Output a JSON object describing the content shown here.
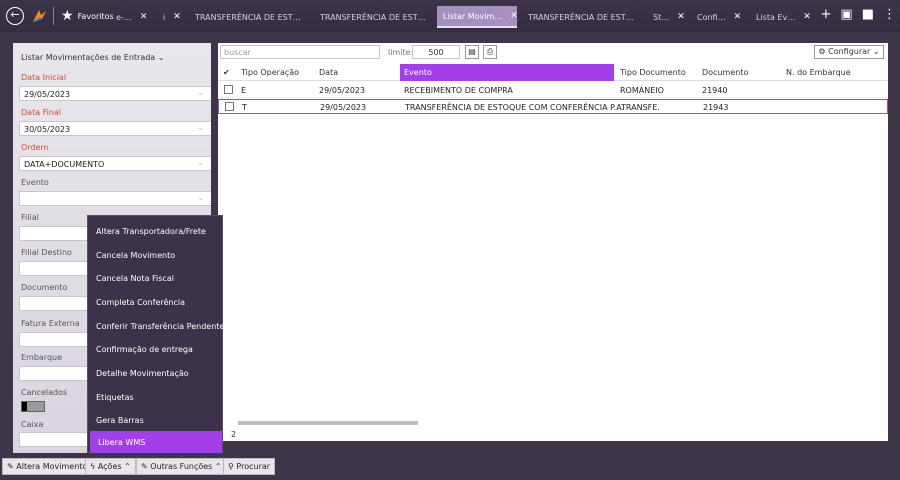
{
  "topbar": {
    "favorites_label": "Favoritos",
    "tabs": [
      {
        "label": "e-…",
        "active": false
      },
      {
        "label": "i",
        "active": false
      },
      {
        "label": "TRANSFERÊNCIA DE EST…",
        "active": false
      },
      {
        "label": "TRANSFERÊNCIA DE EST…",
        "active": false
      },
      {
        "label": "Listar Movim…",
        "active": true
      },
      {
        "label": "TRANSFERÊNCIA DE EST…",
        "active": false
      },
      {
        "label": "St…",
        "active": false
      },
      {
        "label": "Confi…",
        "active": false
      },
      {
        "label": "Lista Ev…",
        "active": false
      }
    ],
    "accent_color": "#a33fe8"
  },
  "sidebar": {
    "title": "Listar Movimentações de Entrada ⌄",
    "filters": [
      {
        "label": "Data Inicial",
        "value": "29/05/2023",
        "required": true
      },
      {
        "label": "Data Final",
        "value": "30/05/2023",
        "required": true
      },
      {
        "label": "Ordem",
        "value": "DATA+DOCUMENTO",
        "required": true
      },
      {
        "label": "Evento",
        "value": "",
        "required": false
      },
      {
        "label": "Filial",
        "value": "",
        "required": false
      },
      {
        "label": "Filial Destino",
        "value": "",
        "required": false
      },
      {
        "label": "Documento",
        "value": "",
        "required": false
      },
      {
        "label": "Fatura Externa",
        "value": "",
        "required": false
      },
      {
        "label": "Embarque",
        "value": "",
        "required": false
      }
    ],
    "cancelados_label": "Cancelados",
    "caixa_label": "Caixa"
  },
  "main": {
    "search_placeholder": "buscar",
    "limite_label": "limite:",
    "limite_value": "500",
    "config_label": "⚙ Configurar ⌄",
    "columns": [
      "Tipo Operação",
      "Data",
      "Evento",
      "Tipo Documento",
      "Documento",
      "N. do Embarque"
    ],
    "rows": [
      {
        "tipo": "E",
        "data": "29/05/2023",
        "evento": "RECEBIMENTO DE COMPRA",
        "tipo_doc": "ROMANEIO",
        "documento": "21940",
        "embarque": ""
      },
      {
        "tipo": "T",
        "data": "29/05/2023",
        "evento": "TRANSFERÊNCIA DE ESTOQUE COM CONFERÊNCIA P.A.",
        "tipo_doc": "TRANSFE.",
        "documento": "21943",
        "embarque": ""
      }
    ],
    "row_count": "2"
  },
  "actions_menu": {
    "items": [
      "Altera Transportadora/Frete",
      "Cancela Movimento",
      "Cancela Nota Fiscal",
      "Completa Conferência",
      "Conferir Transferência Pendente",
      "Confirmação de entrega",
      "Detalhe Movimentação",
      "Etiquetas",
      "Gera Barras",
      "Libera WMS"
    ],
    "highlighted": "Libera WMS"
  },
  "bottombar": {
    "altera_label": "Altera Movimento",
    "acoes_label": "Ações ⌃",
    "outras_label": "Outras Funções ⌃",
    "procurar_label": "Procurar"
  }
}
